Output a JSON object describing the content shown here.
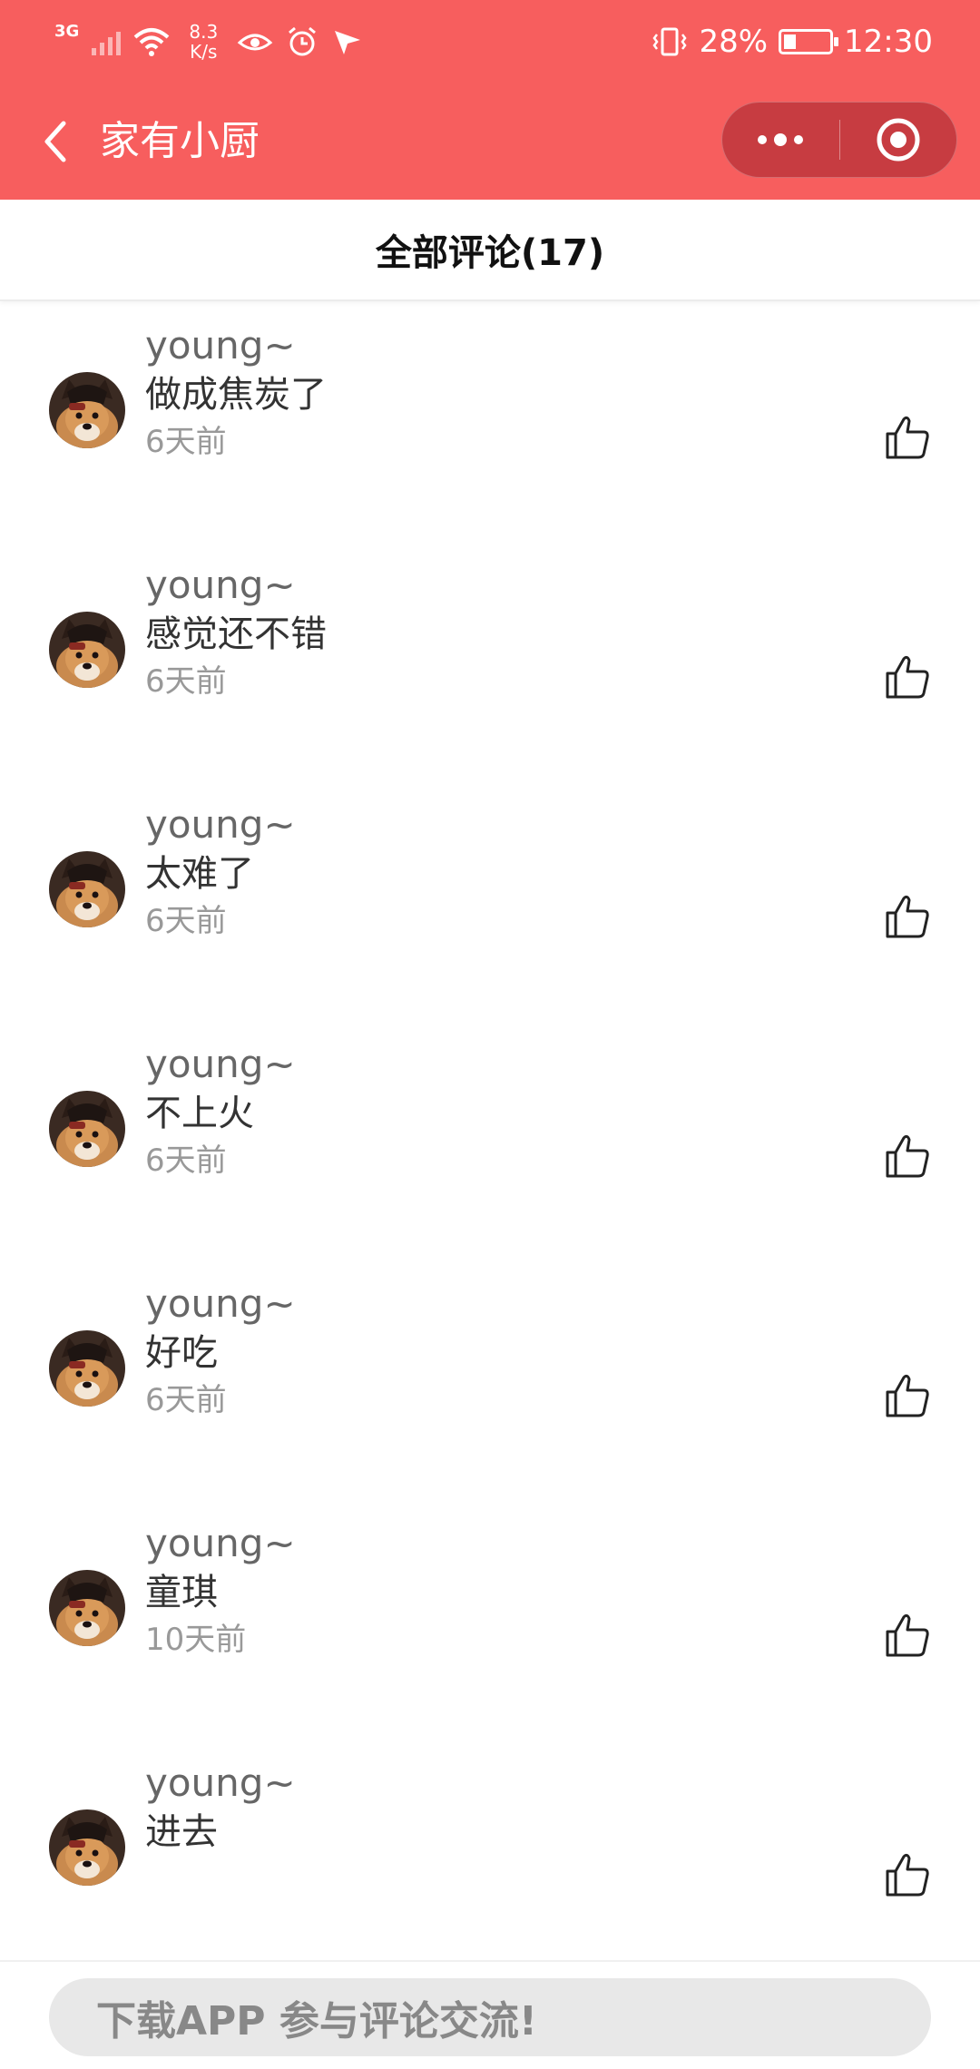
{
  "status_bar": {
    "network": "3G",
    "speed_value": "8.3",
    "speed_unit": "K/s",
    "battery": "28%",
    "battery_level": 0.28,
    "time": "12:30",
    "icons": [
      "signal-icon",
      "wifi-icon",
      "eye-icon",
      "alarm-icon",
      "location-arrow-icon",
      "vibrate-icon",
      "battery-icon"
    ]
  },
  "nav": {
    "title": "家有小厨",
    "back_icon": "chevron-left-icon",
    "more_icon": "more-dots-icon",
    "close_icon": "target-close-icon"
  },
  "header": {
    "title": "全部评论(17)"
  },
  "comments": [
    {
      "user": "young~",
      "text": "做成焦炭了",
      "time": "6天前"
    },
    {
      "user": "young~",
      "text": "感觉还不错",
      "time": "6天前"
    },
    {
      "user": "young~",
      "text": "太难了",
      "time": "6天前"
    },
    {
      "user": "young~",
      "text": "不上火",
      "time": "6天前"
    },
    {
      "user": "young~",
      "text": "好吃",
      "time": "6天前"
    },
    {
      "user": "young~",
      "text": "童琪",
      "time": "10天前"
    },
    {
      "user": "young~",
      "text": "进去",
      "time": ""
    }
  ],
  "bottom": {
    "button_label": "下载APP 参与评论交流!"
  },
  "colors": {
    "brand_red": "#f75e5e",
    "text_primary": "#333333",
    "text_secondary": "#999999"
  }
}
